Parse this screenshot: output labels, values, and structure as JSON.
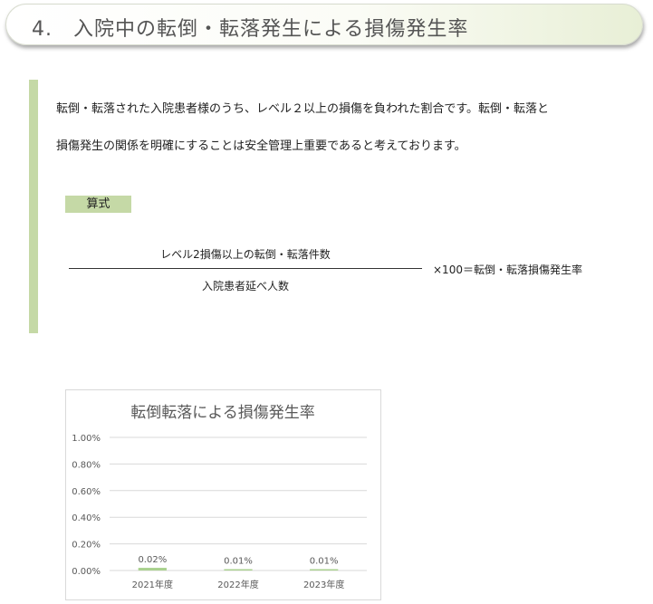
{
  "header": {
    "title": "4.　入院中の転倒・転落発生による損傷発生率"
  },
  "section": {
    "description_line1": "転倒・転落された入院患者様のうち、レベル２以上の損傷を負われた割合です。転倒・転落と",
    "description_line2": "損傷発生の関係を明確にすることは安全管理上重要であると考えております。",
    "formula_label": "算式",
    "numerator": "レベル2損傷以上の転倒・転落件数",
    "denominator": "入院患者延べ人数",
    "result": "×100＝転倒・転落損傷発生率"
  },
  "colors": {
    "accent_green": "#c5d9a6",
    "bar_color": "#a9d18e",
    "grid_color": "#d9d9d9",
    "text_gray": "#595959"
  },
  "chart_data": {
    "type": "bar",
    "title": "転倒転落による損傷発生率",
    "categories": [
      "2021年度",
      "2022年度",
      "2023年度"
    ],
    "values": [
      0.02,
      0.01,
      0.01
    ],
    "data_labels": [
      "0.02%",
      "0.01%",
      "0.01%"
    ],
    "y_ticks": [
      "0.00%",
      "0.20%",
      "0.40%",
      "0.60%",
      "0.80%",
      "1.00%"
    ],
    "ylim": [
      0,
      1.0
    ],
    "y_unit": "%",
    "grid": true,
    "legend": "none"
  }
}
